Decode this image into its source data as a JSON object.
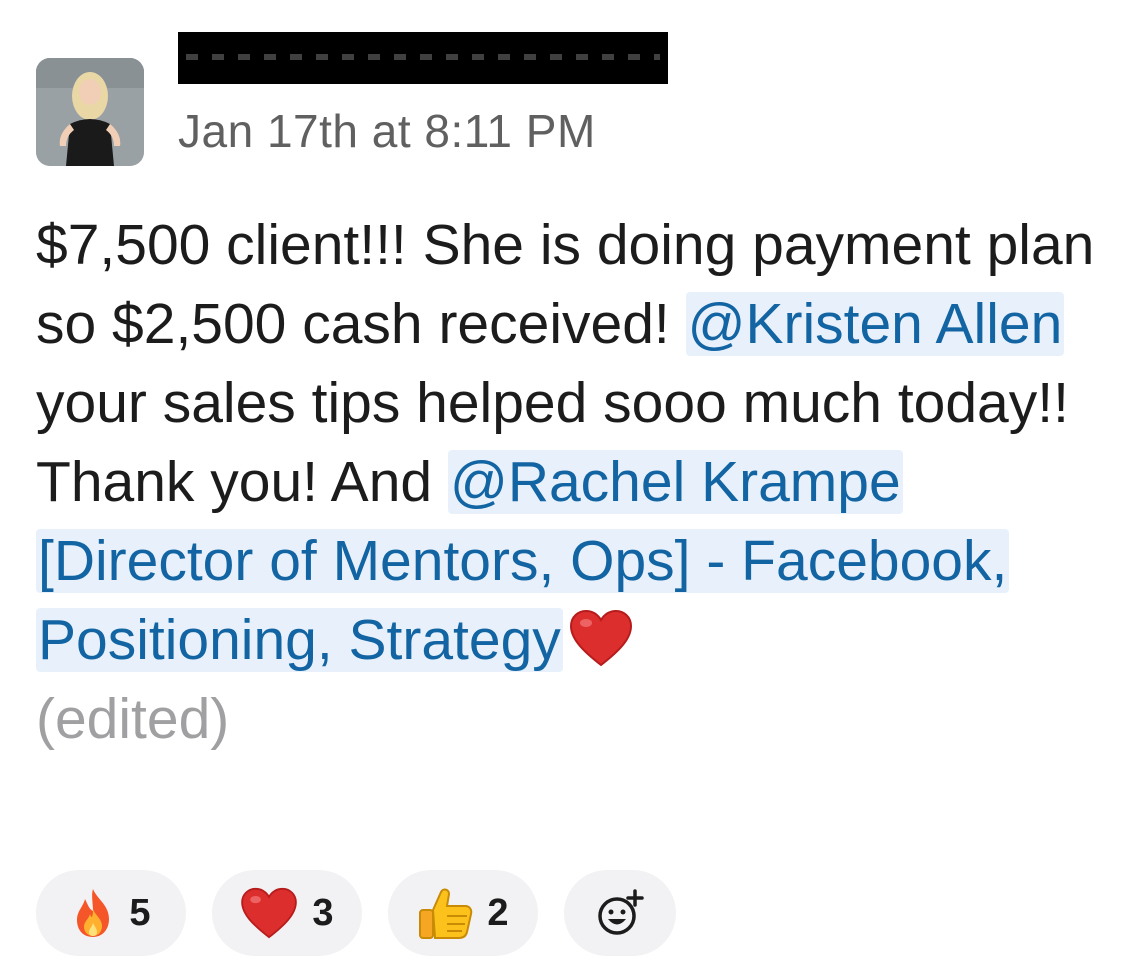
{
  "message": {
    "timestamp": "Jan 17th at 8:11 PM",
    "text_part1": "$7,500 client!!! She is doing payment plan so $2,500 cash received! ",
    "mention1": "@Kristen Allen",
    "text_part2": " your sales tips helped sooo much today!! Thank you! And ",
    "mention2": "@Rachel Krampe [Director of Mentors, Ops] - Facebook, Positioning, Strategy",
    "emoji": "heart-icon",
    "edited_label": "(edited)"
  },
  "reactions": [
    {
      "emoji": "fire-icon",
      "count": "5"
    },
    {
      "emoji": "heart-icon",
      "count": "3"
    },
    {
      "emoji": "thumbs-up-icon",
      "count": "2"
    }
  ],
  "add_reaction": {
    "icon": "add-reaction-icon"
  },
  "colors": {
    "mention_text": "#1264a3",
    "mention_bg": "#e8f1fb",
    "timestamp": "#616061",
    "edited": "#a0a0a2",
    "reaction_bg": "#f2f2f4"
  }
}
